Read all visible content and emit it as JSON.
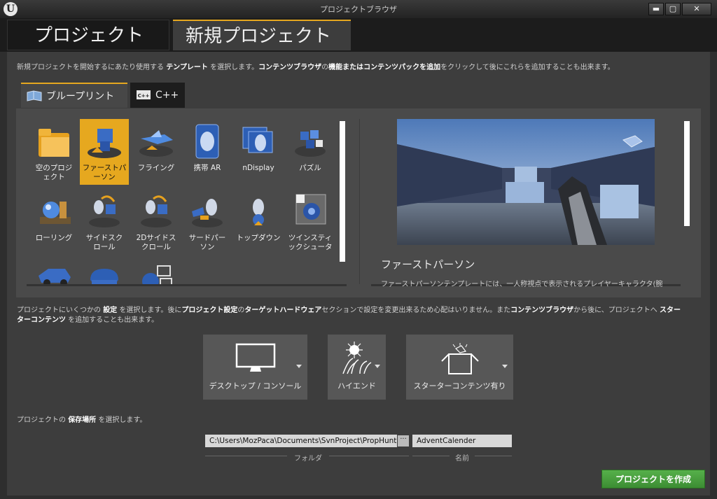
{
  "window": {
    "title": "プロジェクトブラウザ",
    "logo": "U",
    "buttons": {
      "minimize": "▬",
      "maximize": "▢",
      "close": "✕"
    }
  },
  "tabs": {
    "projects": "プロジェクト",
    "new_project": "新規プロジェクト"
  },
  "intro": {
    "p1": "新規プロジェクトを開始するにあたり使用する ",
    "b1": "テンプレート",
    "p2": " を選択します。",
    "b2": "コンテンツブラウザ",
    "p3": "の",
    "b3": "機能またはコンテンツパックを追加",
    "p4": "をクリックして後にこれらを追加することも出来ます。"
  },
  "sub_tabs": {
    "blueprint": "ブループリント",
    "cpp": "C++",
    "cpp_icon_text": "C++"
  },
  "templates": [
    {
      "label_line1": "空のプロジ",
      "label_line2": "ェクト",
      "icon": "folder-icon",
      "selected": false
    },
    {
      "label_line1": "ファーストパ",
      "label_line2": "ーソン",
      "icon": "first-person-icon",
      "selected": true
    },
    {
      "label_line1": "フライング",
      "label_line2": "",
      "icon": "flying-icon",
      "selected": false
    },
    {
      "label_line1": "携帯 AR",
      "label_line2": "",
      "icon": "handheld-ar-icon",
      "selected": false
    },
    {
      "label_line1": "nDisplay",
      "label_line2": "",
      "icon": "ndisplay-icon",
      "selected": false
    },
    {
      "label_line1": "パズル",
      "label_line2": "",
      "icon": "puzzle-icon",
      "selected": false
    },
    {
      "label_line1": "ローリング",
      "label_line2": "",
      "icon": "rolling-icon",
      "selected": false
    },
    {
      "label_line1": "サイドスク",
      "label_line2": "ロール",
      "icon": "side-scroller-icon",
      "selected": false
    },
    {
      "label_line1": "2Dサイドス",
      "label_line2": "クロール",
      "icon": "2d-side-scroller-icon",
      "selected": false
    },
    {
      "label_line1": "サードパー",
      "label_line2": "ソン",
      "icon": "third-person-icon",
      "selected": false
    },
    {
      "label_line1": "トップダウン",
      "label_line2": "",
      "icon": "top-down-icon",
      "selected": false
    },
    {
      "label_line1": "ツインスティ",
      "label_line2": "ックシュータ",
      "icon": "twin-stick-icon",
      "selected": false
    },
    {
      "label_line1": "",
      "label_line2": "",
      "icon": "vehicle-icon",
      "selected": false
    },
    {
      "label_line1": "",
      "label_line2": "",
      "icon": "vr-icon",
      "selected": false
    },
    {
      "label_line1": "",
      "label_line2": "",
      "icon": "virtual-production-icon",
      "selected": false
    }
  ],
  "preview": {
    "title": "ファーストパーソン",
    "description": "ファーストパーソンテンプレートには、一人称視点で表示されるプレイヤーキャラクタ(腕"
  },
  "settings_desc": {
    "p1": "プロジェクトにいくつかの ",
    "b1": "設定",
    "p2": " を選択します。後に",
    "b2": "プロジェクト設定",
    "p3": "の",
    "b3": "ターゲットハードウェア",
    "p4": "セクションで設定を変更出来るため心配はいりません。また",
    "b4": "コンテンツブラウザ",
    "p5": "から後に、プロジェクトへ ",
    "b5": "スター",
    "b6": "ターコンテンツ",
    "p6": " を追加することも出来ます。"
  },
  "settings": [
    {
      "label": "デスクトップ / コンソール",
      "icon": "monitor-icon"
    },
    {
      "label": "ハイエンド",
      "icon": "high-end-icon"
    },
    {
      "label": "スターターコンテンツ有り",
      "icon": "starter-content-box-icon"
    }
  ],
  "location_desc": {
    "p1": "プロジェクトの ",
    "b1": "保存場所",
    "p2": " を選択します。"
  },
  "folder": {
    "value": "C:\\Users\\MozPaca\\Documents\\SvnProject\\PropHunt",
    "caption": "フォルダ",
    "browse": "···"
  },
  "name": {
    "value": "AdventCalender",
    "caption": "名前"
  },
  "create_button": "プロジェクトを作成",
  "colors": {
    "accent": "#e6a81f",
    "create": "#4a9e3f"
  }
}
